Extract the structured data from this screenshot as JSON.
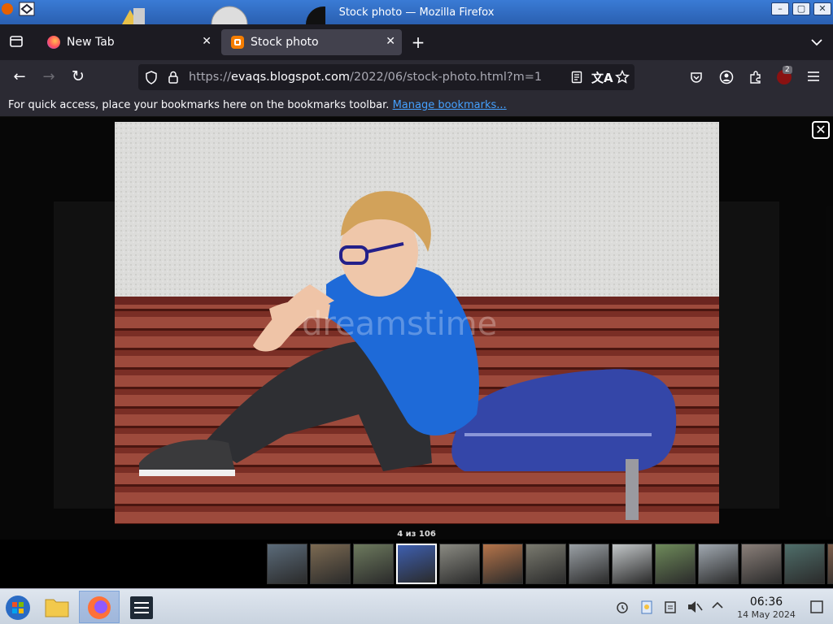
{
  "window": {
    "title": "Stock photo — Mozilla Firefox",
    "controls": [
      "–",
      "▢",
      "✕"
    ]
  },
  "tabs": [
    {
      "label": "New Tab",
      "active": false,
      "favicon": "firefox-icon"
    },
    {
      "label": "Stock photo",
      "active": true,
      "favicon": "blogger-icon"
    }
  ],
  "toolbar": {
    "new_tab": "+",
    "list_all_tabs": "⌄",
    "back": "←",
    "forward": "→",
    "reload": "↻"
  },
  "urlbar": {
    "scheme": "https://",
    "host": "evaqs.blogspot.com",
    "path": "/2022/06/stock-photo.html?m=1"
  },
  "extensions": {
    "badge_count": "2"
  },
  "bookmarks_bar": {
    "message": "For quick access, place your bookmarks here on the bookmarks toolbar. ",
    "link": "Manage bookmarks..."
  },
  "lightbox": {
    "counter": "4 из 106",
    "watermark": "dreamstime",
    "close": "✕",
    "thumbnail_count": 14,
    "active_thumbnail_index": 3
  },
  "taskbar": {
    "time": "06:36",
    "date": "14 May 2024"
  },
  "colors": {
    "tab_bar_bg": "#1c1b22",
    "nav_bar_bg": "#2b2a33",
    "active_tab_bg": "#42414d",
    "link": "#45a1ff",
    "blogger_orange": "#f57d00"
  }
}
